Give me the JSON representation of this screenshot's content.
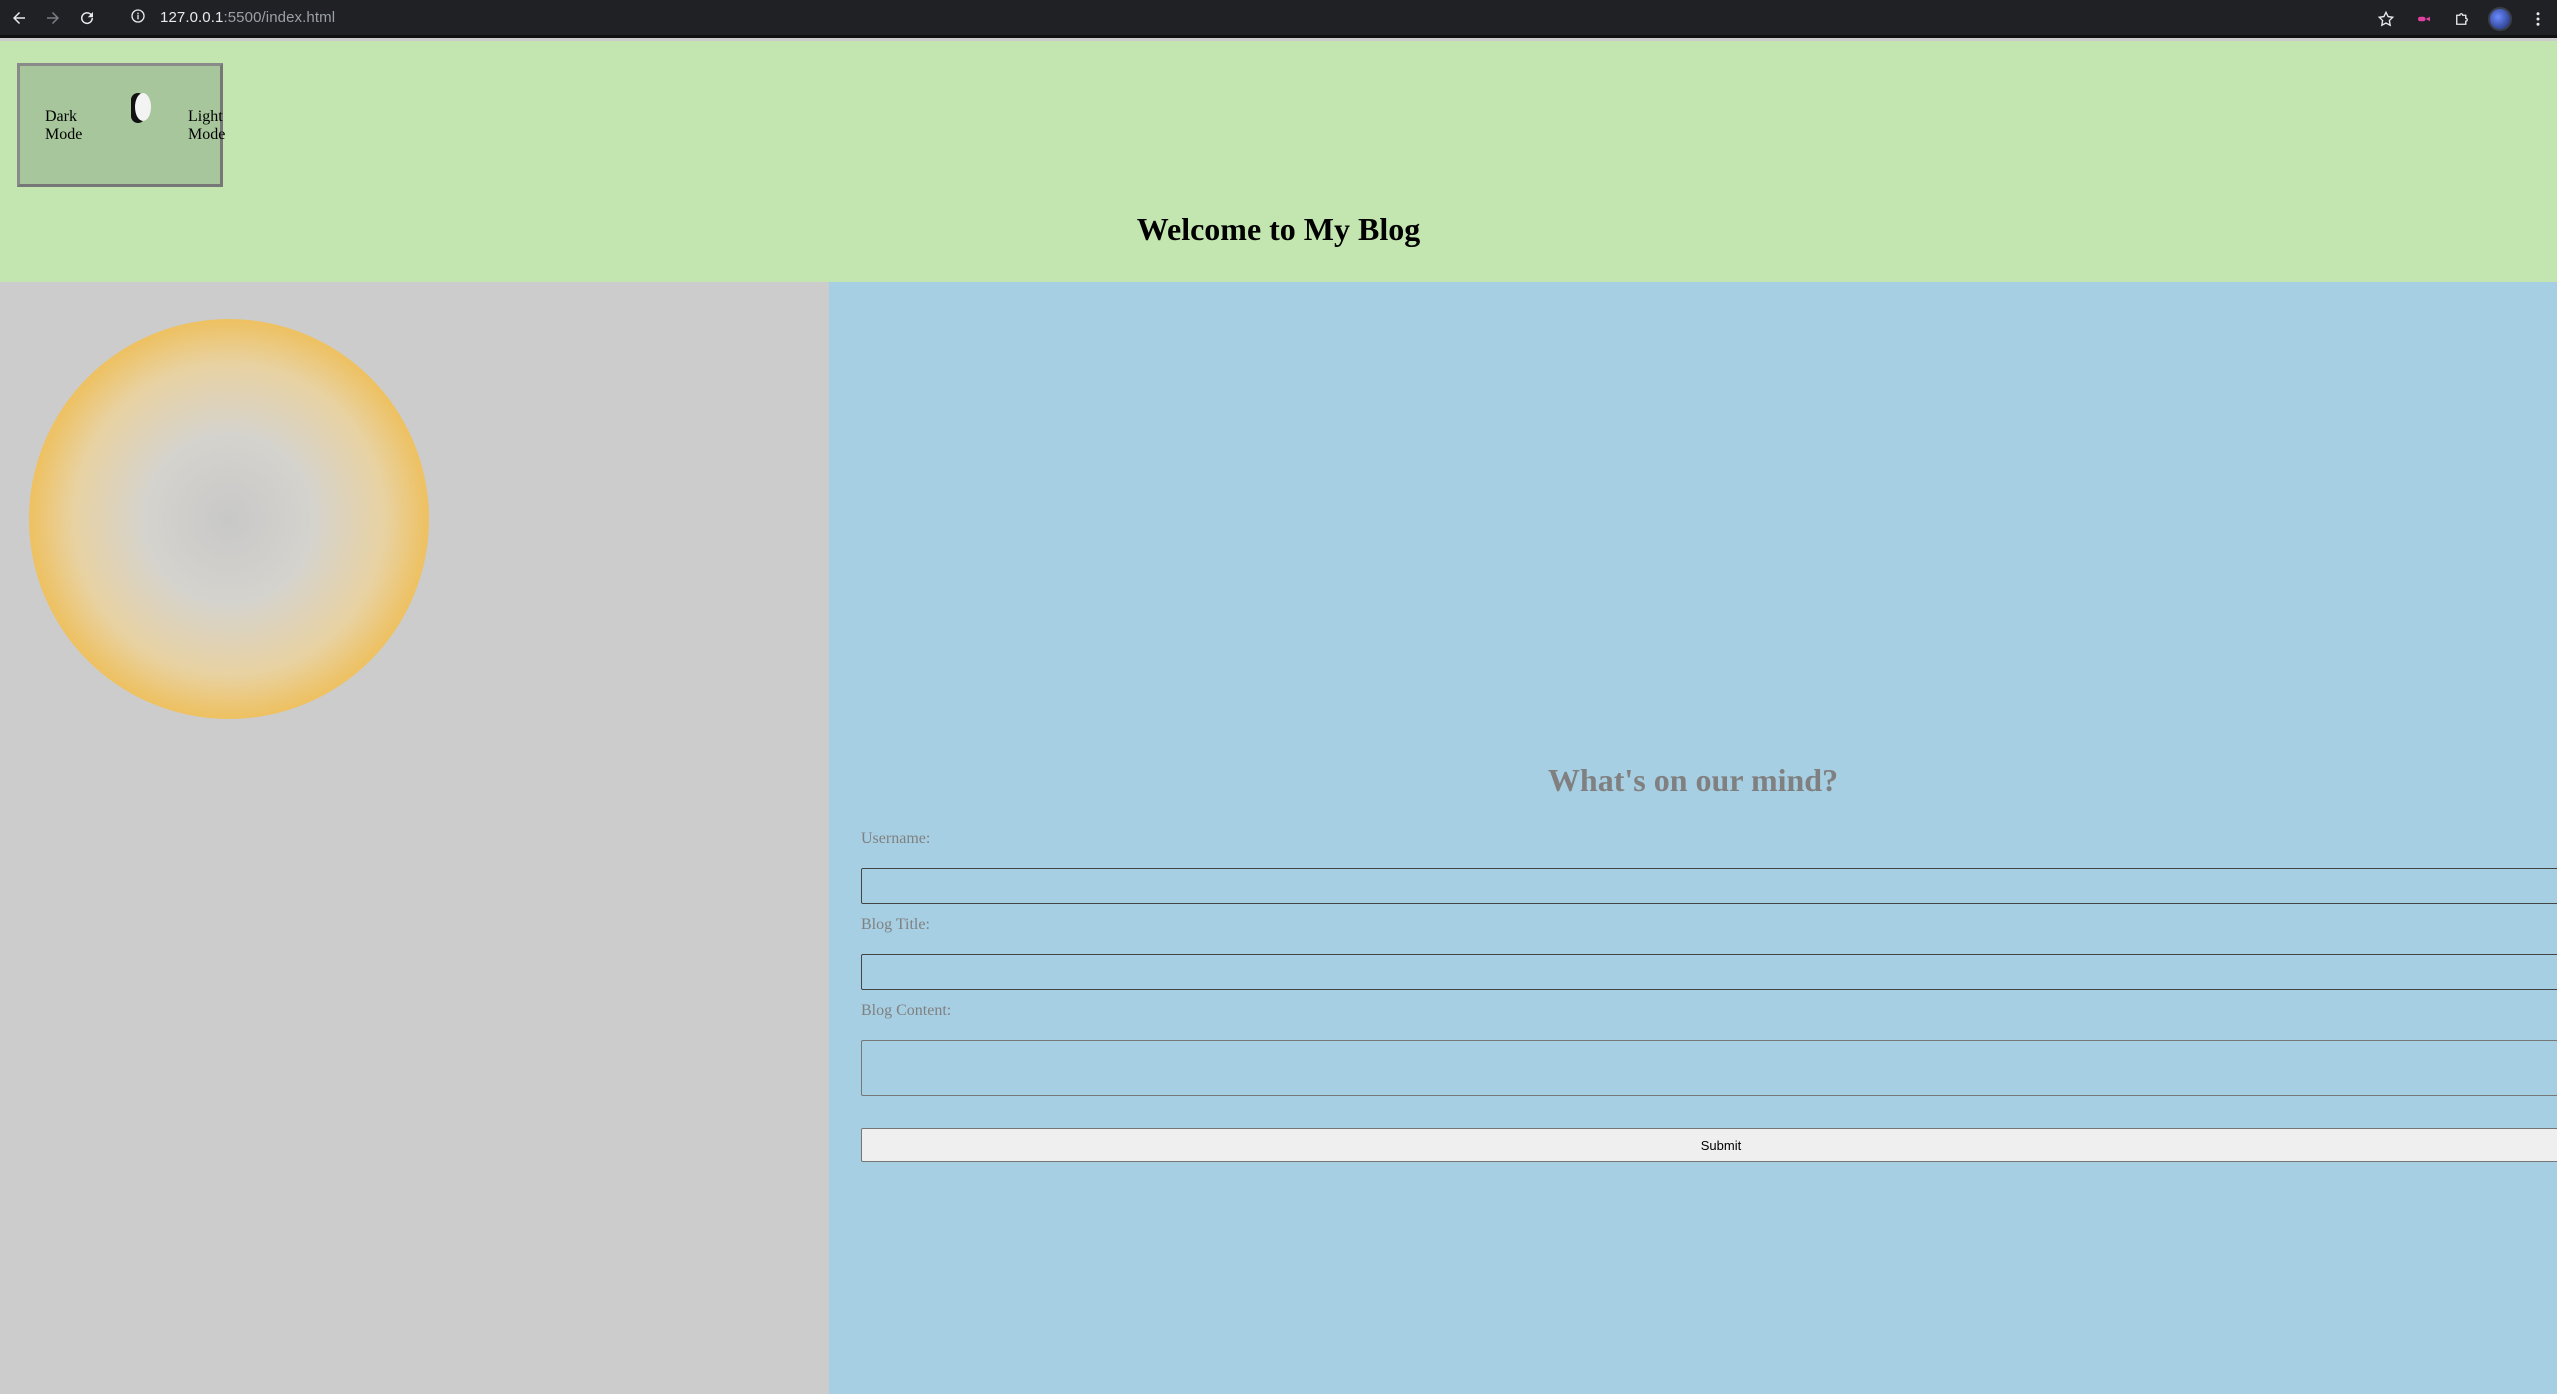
{
  "browser": {
    "url_host": "127.0.0.1",
    "url_rest": ":5500/index.html",
    "icons": [
      "back-arrow-icon",
      "forward-arrow-icon",
      "reload-icon",
      "site-info-icon",
      "bookmark-star-icon",
      "extension-icon",
      "puzzle-icon",
      "profile-avatar",
      "menu-dots-icon"
    ]
  },
  "header": {
    "mode_toggle": {
      "dark_label": "Dark Mode",
      "light_label": "Light Mode"
    },
    "title": "Welcome to My Blog",
    "background_color": "#c3e6b0"
  },
  "left_panel": {
    "background_color": "#cccccc",
    "sun_colors": [
      "#c8c8c8",
      "#f6a50b"
    ]
  },
  "form": {
    "heading": "What's on our mind?",
    "username_label": "Username:",
    "username_value": "",
    "title_label": "Blog Title:",
    "title_value": "",
    "content_label": "Blog Content:",
    "content_value": "",
    "submit_label": "Submit",
    "background_color": "#a7cfe3"
  }
}
